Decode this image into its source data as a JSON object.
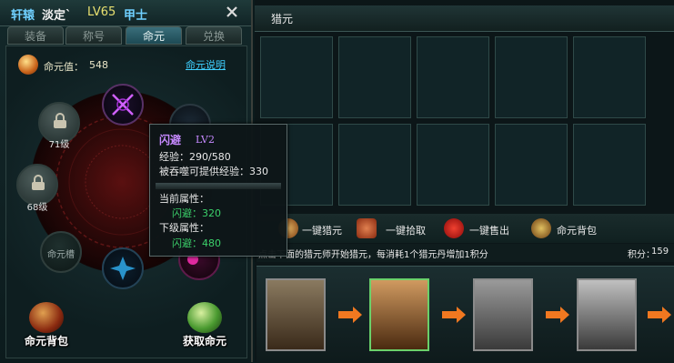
{
  "header": {
    "player_name": "轩辕",
    "player_suffix": "淡定`",
    "level": "LV65",
    "class_name": "甲士"
  },
  "tabs": [
    {
      "label": "装备",
      "active": false
    },
    {
      "label": "称号",
      "active": false
    },
    {
      "label": "命元",
      "active": true
    },
    {
      "label": "兑换",
      "active": false
    }
  ],
  "mingyuan": {
    "value_label": "命元值：",
    "value": "548",
    "help_link": "命元说明"
  },
  "slots": {
    "lv71": "71级",
    "lv68": "68级",
    "empty": "命元槽"
  },
  "buttons": {
    "bag": "命元背包",
    "get": "获取命元"
  },
  "tooltip": {
    "title": "闪避",
    "level": "LV2",
    "exp": "经验：290/580",
    "devour": "被吞噬可提供经验：330",
    "current_label": "当前属性：",
    "current_value": "闪避：320",
    "next_label": "下级属性：",
    "next_value": "闪避：480"
  },
  "hunt": {
    "title": "猎元",
    "actions": [
      "一键猎元",
      "一键拾取",
      "一键售出",
      "命元背包"
    ],
    "hint": "点击下面的猎元师开始猎元，每消耗1个猎元丹增加1积分",
    "points_label": "积分：",
    "points_value": "159"
  }
}
